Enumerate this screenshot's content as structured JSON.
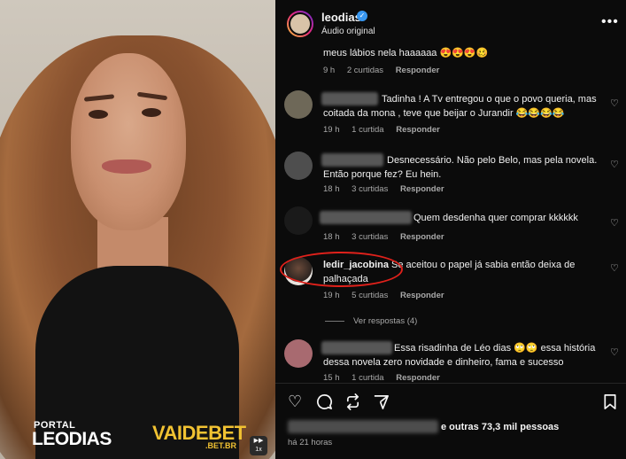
{
  "video": {
    "brand_portal": "PORTAL",
    "brand_leodias": "LEODIAS",
    "sponsor_name": "VAIDEBET",
    "sponsor_domain": ".BET.BR",
    "playback_speed": "1x"
  },
  "header": {
    "username": "leodias",
    "verified_icon": "verified-badge-icon",
    "audio_label": "Áudio original",
    "more_icon": "more-options-icon"
  },
  "comments": [
    {
      "text": "meus lábios nela haaaaaa 😍😍😍🥴",
      "time": "9 h",
      "likes": "2 curtidas",
      "reply": "Responder"
    },
    {
      "text": "Tadinha ! A Tv entregou o que o povo queria, mas coitada da mona , teve que beijar o Jurandir 😂😂😂😂",
      "time": "19 h",
      "likes": "1 curtida",
      "reply": "Responder"
    },
    {
      "text": "Desnecessário. Não pelo Belo, mas pela novela. Então porque fez? Eu hein.",
      "time": "18 h",
      "likes": "3 curtidas",
      "reply": "Responder"
    },
    {
      "text": "Quem desdenha quer comprar kkkkkk",
      "time": "18 h",
      "likes": "3 curtidas",
      "reply": "Responder"
    },
    {
      "username": "ledir_jacobina",
      "text": "Se aceitou o papel já sabia então deixa de palhaçada",
      "time": "19 h",
      "likes": "5 curtidas",
      "reply": "Responder"
    },
    {
      "text": "Essa risadinha de Léo dias 🙄🙄 essa história dessa novela zero novidade e dinheiro, fama e sucesso",
      "time": "15 h",
      "likes": "1 curtida",
      "reply": "Responder"
    }
  ],
  "view_replies": "Ver respostas (4)",
  "footer": {
    "likes_text": "e outras 73,3 mil pessoas",
    "time_ago": "há 21 horas"
  },
  "colors": {
    "background": "#0b0b0b",
    "verified": "#3897f0",
    "highlight_circle": "#e0211b",
    "sponsor": "#f1c232"
  }
}
